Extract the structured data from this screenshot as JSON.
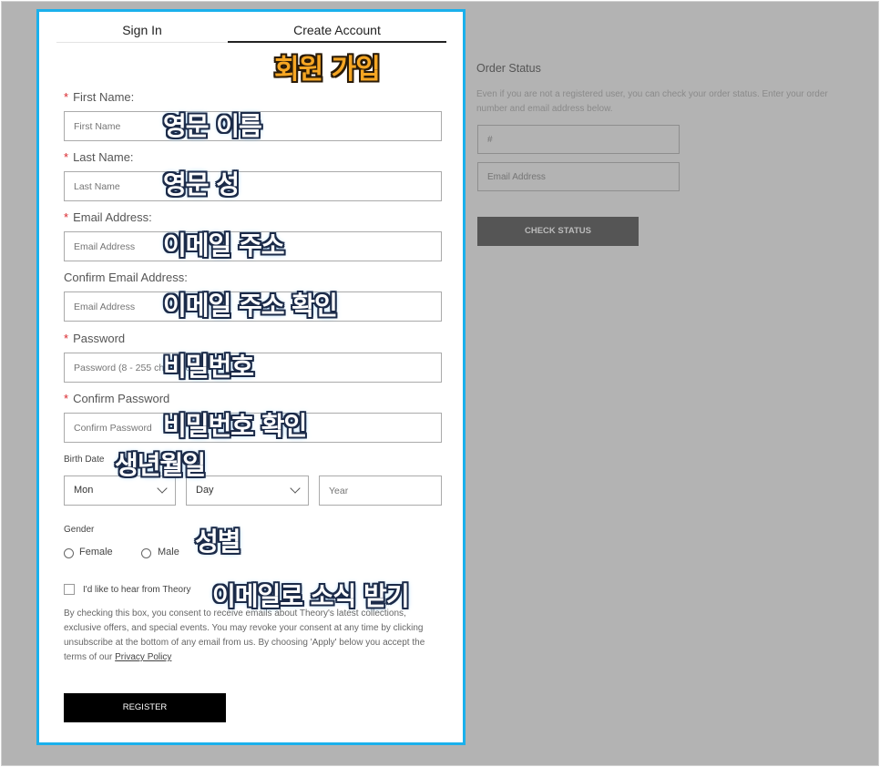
{
  "tabs": {
    "sign_in": "Sign In",
    "create_account": "Create Account",
    "active": "create_account"
  },
  "form": {
    "required_mark": "*",
    "first_name": {
      "label": "First Name:",
      "placeholder": "First Name"
    },
    "last_name": {
      "label": "Last Name:",
      "placeholder": "Last Name"
    },
    "email": {
      "label": "Email Address:",
      "placeholder": "Email Address"
    },
    "confirm_email": {
      "label": "Confirm Email Address:",
      "placeholder": "Email Address"
    },
    "password": {
      "label": "Password",
      "placeholder": "Password (8 - 255 characters)"
    },
    "confirm_password": {
      "label": "Confirm Password",
      "placeholder": "Confirm Password"
    },
    "birth_date": {
      "label": "Birth Date",
      "month": "Mon",
      "day": "Day",
      "year_placeholder": "Year"
    },
    "gender": {
      "label": "Gender",
      "options": [
        "Female",
        "Male"
      ]
    },
    "newsletter": {
      "label": "I'd like to hear from Theory",
      "checked": false
    },
    "consent_text": "By checking this box, you consent to receive emails about Theory's latest collections, exclusive offers, and special events. You may revoke your consent at any time by clicking unsubscribe at the bottom of any email from us. By choosing 'Apply' below you accept the terms of our ",
    "privacy_link": "Privacy Policy",
    "register": "REGISTER"
  },
  "order_status": {
    "title": "Order Status",
    "description": "Even if you are not a registered user, you can check your order status. Enter your order number and email address below.",
    "order_placeholder": "#",
    "email_placeholder": "Email Address",
    "button": "CHECK STATUS"
  },
  "annotations": {
    "create_account": "회원 가입",
    "first_name": "영문 이름",
    "last_name": "영문 성",
    "email": "이메일 주소",
    "confirm_email": "이메일 주소 확인",
    "password": "비밀번호",
    "confirm_password": "비밀번호 확인",
    "birth_date": "생년월일",
    "gender": "성별",
    "newsletter": "이메일로 소식 받기"
  },
  "colors": {
    "highlight_border": "#1ab0ec",
    "overlay": "#b3b3b3",
    "register_button": "#000000",
    "check_status_button": "#555555",
    "required": "#d9262c"
  }
}
